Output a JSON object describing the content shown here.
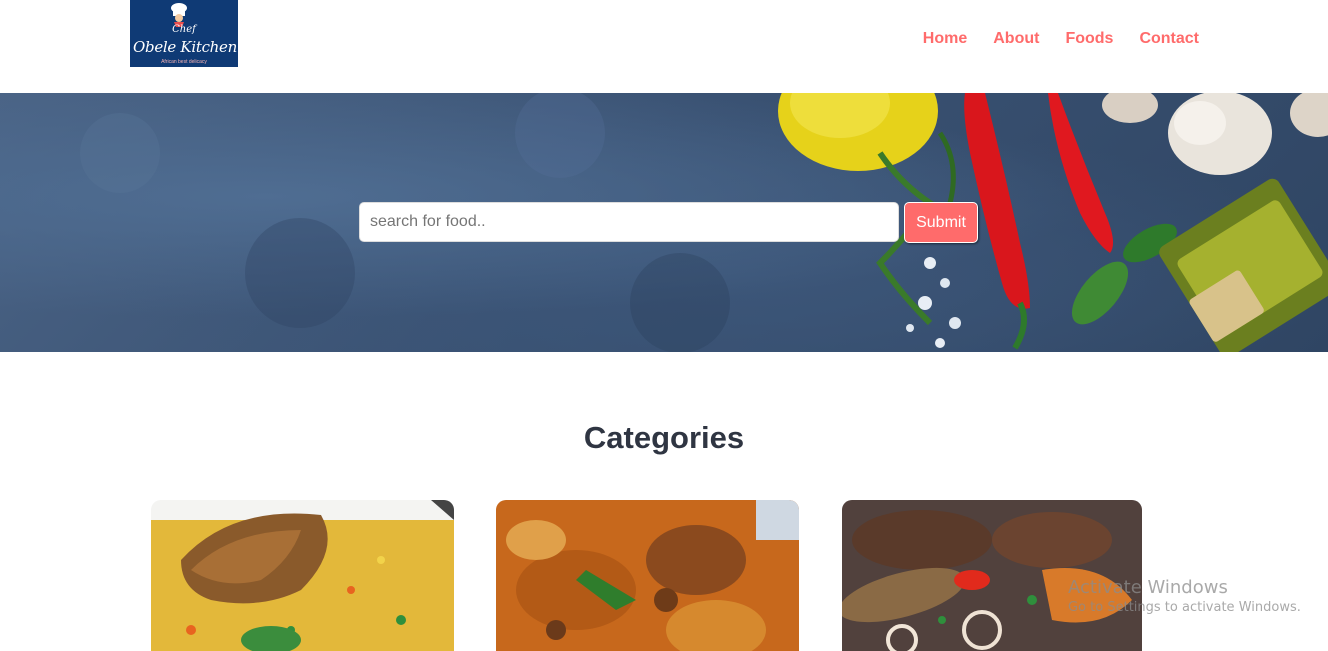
{
  "header": {
    "logo": {
      "chef_word": "Chef",
      "brand": "Obele Kitchen",
      "tagline": "African best delicacy"
    },
    "nav": [
      {
        "label": "Home"
      },
      {
        "label": "About"
      },
      {
        "label": "Foods"
      },
      {
        "label": "Contact"
      }
    ]
  },
  "hero": {
    "search": {
      "placeholder": "search for food..",
      "value": ""
    },
    "submit_label": "Submit"
  },
  "categories": {
    "title": "Categories",
    "cards": [
      {
        "image": "jollof-rice-chicken-image"
      },
      {
        "image": "pepper-soup-image"
      },
      {
        "image": "fried-fish-plantain-image"
      }
    ]
  },
  "watermark": {
    "line1": "Activate Windows",
    "line2": "Go to Settings to activate Windows."
  },
  "colors": {
    "accent": "#ff6b6b",
    "heading": "#2f3542",
    "logo_bg": "#0f3a75"
  }
}
